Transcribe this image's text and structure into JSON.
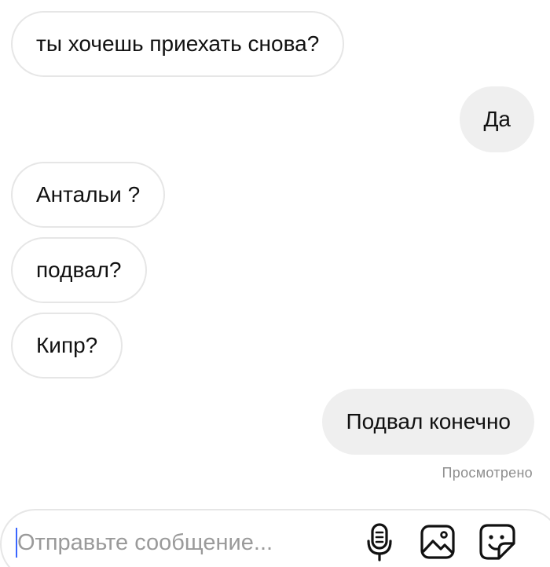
{
  "messages": [
    {
      "direction": "incoming",
      "text": "ты хочешь приехать снова?"
    },
    {
      "direction": "outgoing",
      "text": "Да"
    },
    {
      "direction": "incoming",
      "text": "Антальи ?"
    },
    {
      "direction": "incoming",
      "text": "подвал?"
    },
    {
      "direction": "incoming",
      "text": "Кипр?"
    },
    {
      "direction": "outgoing",
      "text": "Подвал конечно"
    }
  ],
  "seen_status": "Просмотрено",
  "composer": {
    "placeholder": "Отправьте сообщение...",
    "value": ""
  },
  "icons": {
    "mic": "microphone-icon",
    "image": "image-icon",
    "sticker": "sticker-icon"
  },
  "colors": {
    "outgoing_bubble": "#efefef",
    "incoming_border": "#e6e6e6",
    "caret": "#3a66ff",
    "muted_text": "#8e8e8e"
  }
}
